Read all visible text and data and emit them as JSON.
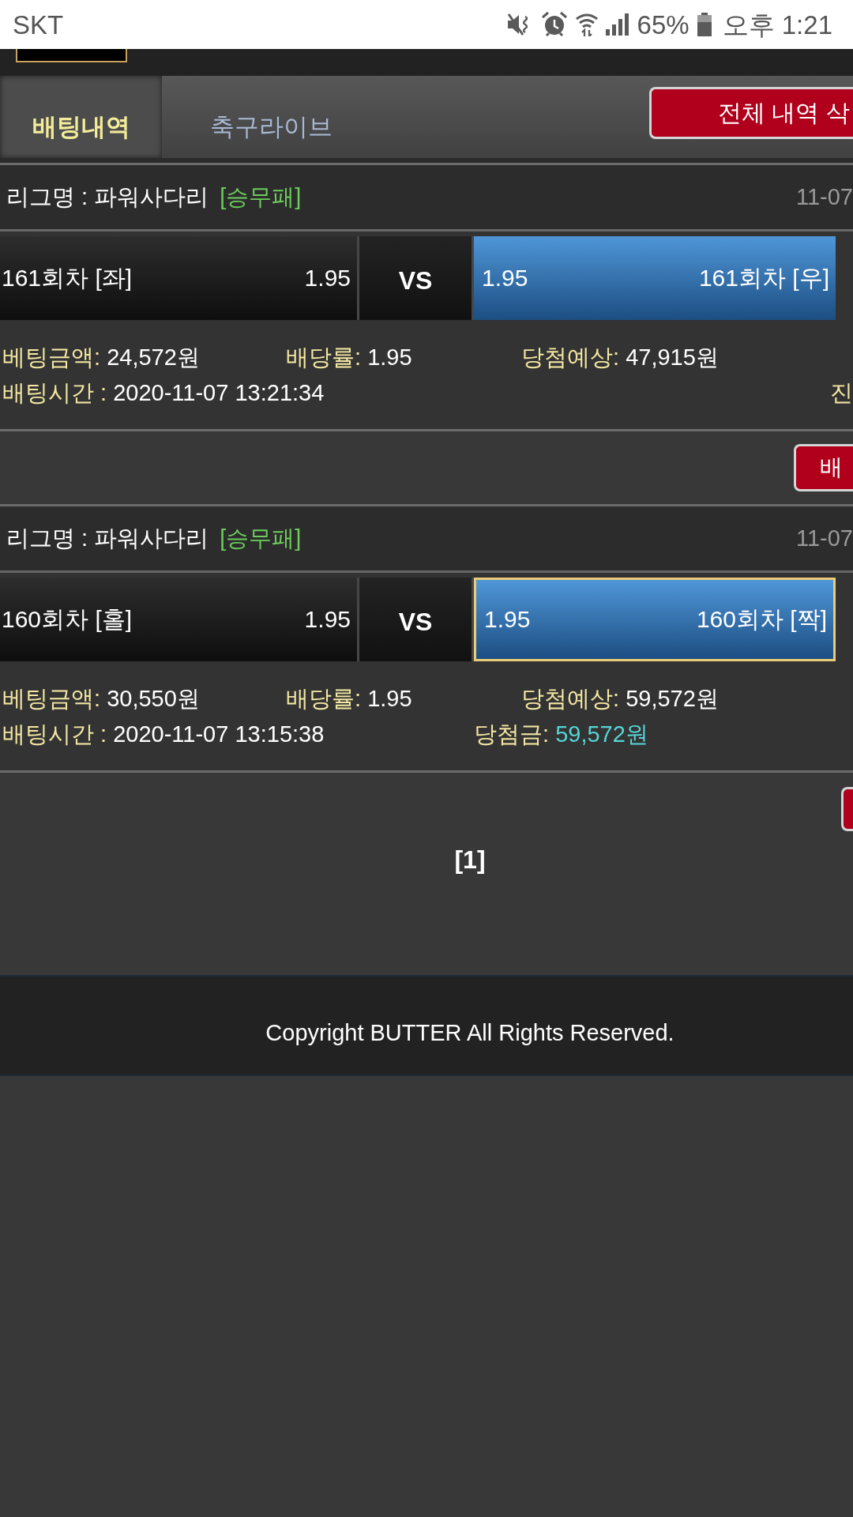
{
  "status_bar": {
    "carrier": "SKT",
    "battery": "65%",
    "time": "오후 1:21"
  },
  "tabs": [
    {
      "label": "배팅내역",
      "selected": true
    },
    {
      "label": "축구라이브",
      "selected": false
    }
  ],
  "delete_all_button": {
    "label": "전체 내역 삭"
  },
  "bets": [
    {
      "league": "리그명 : 파워사다리",
      "market": "[승무패]",
      "date": "11-07",
      "options": [
        {
          "name": "161회차 [좌]",
          "odds": "1.95",
          "selected": false,
          "highlighted": false
        },
        {
          "name": "161회차 [우]",
          "odds": "1.95",
          "selected": true,
          "highlighted": false
        }
      ],
      "vs": "VS",
      "details": [
        {
          "label": "베팅금액:",
          "value": "24,572원"
        },
        {
          "label": "배당률:",
          "value": "1.95"
        },
        {
          "label": "당첨예상:",
          "value": "47,915원"
        }
      ],
      "bet_time": {
        "label": "배팅시간 :",
        "value": "2020-11-07 13:21:34"
      },
      "status": "진",
      "action_button": {
        "kind": "full",
        "label": "배"
      }
    },
    {
      "league": "리그명 : 파워사다리",
      "market": "[승무패]",
      "date": "11-07",
      "options": [
        {
          "name": "160회차 [홀]",
          "odds": "1.95",
          "selected": false,
          "highlighted": false
        },
        {
          "name": "160회차 [짝]",
          "odds": "1.95",
          "selected": true,
          "highlighted": true
        }
      ],
      "vs": "VS",
      "details": [
        {
          "label": "베팅금액:",
          "value": "30,550원"
        },
        {
          "label": "배당률:",
          "value": "1.95"
        },
        {
          "label": "당첨예상:",
          "value": "59,572원"
        }
      ],
      "bet_time": {
        "label": "배팅시간 :",
        "value": "2020-11-07 13:15:38"
      },
      "payout": {
        "label": "당첨금:",
        "value": "59,572원"
      },
      "action_button": {
        "kind": "edge"
      }
    }
  ],
  "pagination": "[1]",
  "copyright": "Copyright BUTTER All Rights Reserved."
}
